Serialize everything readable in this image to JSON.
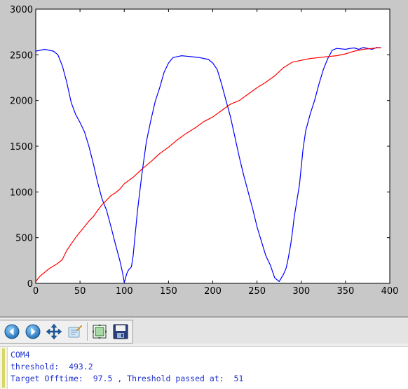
{
  "toolbar": {
    "buttons": [
      {
        "name": "back-button",
        "icon": "arrow-left-icon"
      },
      {
        "name": "forward-button",
        "icon": "arrow-right-icon"
      },
      {
        "name": "pan-button",
        "icon": "move-arrows-icon"
      },
      {
        "name": "zoom-rect-button",
        "icon": "zoom-rect-icon"
      },
      {
        "name": "configure-subplots-button",
        "icon": "subplots-icon"
      },
      {
        "name": "save-button",
        "icon": "floppy-disk-icon"
      }
    ]
  },
  "console": {
    "lines": [
      "COM4",
      "threshold:  493.2",
      "Target Offtime:  97.5 , Threshold passed at:  51"
    ],
    "text_color": "#2233cc"
  },
  "chart_data": {
    "type": "line",
    "xlim": [
      0,
      400
    ],
    "ylim": [
      0,
      3000
    ],
    "x_ticks": [
      "0",
      "50",
      "100",
      "150",
      "200",
      "250",
      "300",
      "350",
      "400"
    ],
    "y_ticks": [
      "0",
      "500",
      "1000",
      "1500",
      "2000",
      "2500",
      "3000"
    ],
    "grid": false,
    "series": [
      {
        "color": "#0000ff",
        "x": [
          0,
          10,
          20,
          25,
          30,
          35,
          40,
          45,
          50,
          55,
          60,
          65,
          70,
          75,
          80,
          85,
          90,
          95,
          98,
          100,
          103,
          105,
          108,
          110,
          112,
          115,
          120,
          125,
          130,
          135,
          140,
          145,
          150,
          155,
          160,
          165,
          170,
          175,
          180,
          185,
          190,
          195,
          200,
          205,
          210,
          215,
          220,
          225,
          230,
          235,
          240,
          245,
          250,
          255,
          260,
          265,
          270,
          275,
          280,
          283,
          285,
          288,
          290,
          292,
          295,
          298,
          300,
          302,
          305,
          310,
          315,
          320,
          325,
          330,
          335,
          340,
          345,
          350,
          355,
          360,
          365,
          370,
          375,
          380,
          385,
          390
        ],
        "y": [
          2540,
          2560,
          2540,
          2500,
          2380,
          2200,
          1980,
          1850,
          1760,
          1660,
          1500,
          1310,
          1100,
          920,
          800,
          620,
          430,
          250,
          120,
          10,
          110,
          150,
          180,
          300,
          500,
          800,
          1200,
          1550,
          1780,
          1990,
          2140,
          2310,
          2410,
          2470,
          2480,
          2490,
          2485,
          2480,
          2475,
          2470,
          2460,
          2450,
          2410,
          2340,
          2180,
          2000,
          1820,
          1600,
          1380,
          1180,
          1000,
          820,
          620,
          460,
          300,
          200,
          60,
          20,
          100,
          170,
          260,
          420,
          560,
          720,
          900,
          1080,
          1280,
          1470,
          1670,
          1850,
          2000,
          2180,
          2340,
          2460,
          2550,
          2570,
          2565,
          2560,
          2570,
          2575,
          2560,
          2580,
          2570,
          2560,
          2580,
          2575
        ]
      },
      {
        "color": "#ff0000",
        "x": [
          0,
          5,
          10,
          15,
          20,
          25,
          30,
          35,
          40,
          45,
          50,
          55,
          60,
          65,
          70,
          75,
          80,
          85,
          90,
          95,
          100,
          110,
          120,
          130,
          140,
          150,
          160,
          170,
          180,
          190,
          200,
          210,
          220,
          230,
          240,
          250,
          260,
          270,
          280,
          290,
          300,
          310,
          320,
          330,
          340,
          350,
          360,
          370,
          380,
          390
        ],
        "y": [
          20,
          80,
          120,
          160,
          190,
          220,
          260,
          360,
          430,
          500,
          560,
          620,
          680,
          730,
          800,
          860,
          910,
          960,
          990,
          1030,
          1090,
          1160,
          1250,
          1330,
          1420,
          1490,
          1570,
          1640,
          1700,
          1770,
          1820,
          1890,
          1960,
          2000,
          2070,
          2140,
          2200,
          2270,
          2360,
          2420,
          2440,
          2460,
          2470,
          2480,
          2490,
          2510,
          2540,
          2560,
          2570,
          2580
        ]
      }
    ]
  }
}
